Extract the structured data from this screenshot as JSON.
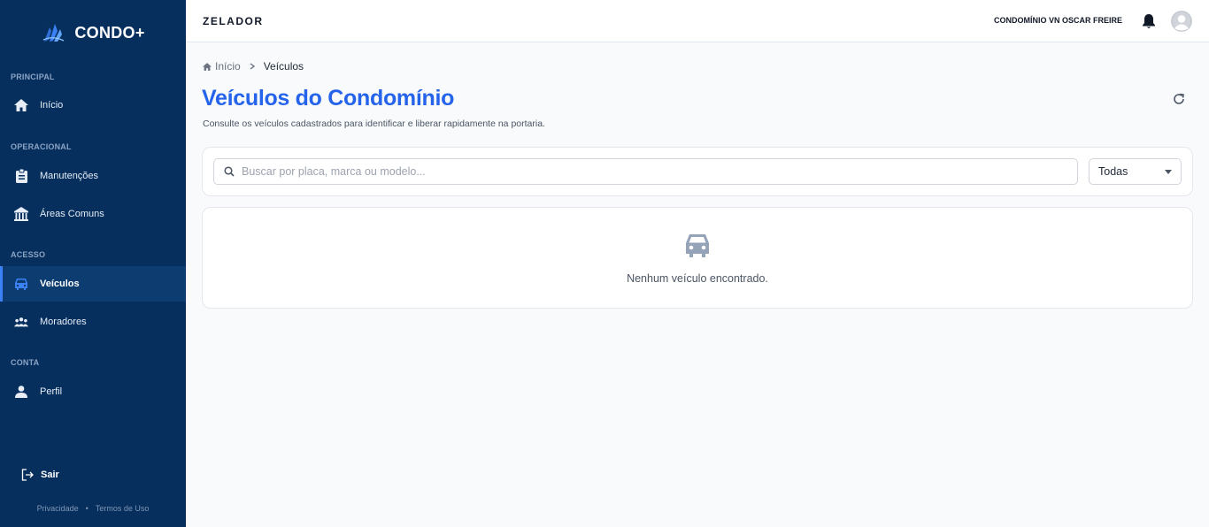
{
  "brand": {
    "name": "CONDO+"
  },
  "sidebar": {
    "sections": [
      {
        "label": "PRINCIPAL"
      },
      {
        "label": "OPERACIONAL"
      },
      {
        "label": "ACESSO"
      },
      {
        "label": "CONTA"
      }
    ],
    "items": [
      {
        "label": "Início",
        "icon": "home-icon",
        "active": false
      },
      {
        "label": "Manutenções",
        "icon": "clipboard-icon",
        "active": false
      },
      {
        "label": "Áreas Comuns",
        "icon": "building-icon",
        "active": false
      },
      {
        "label": "Veículos",
        "icon": "car-icon",
        "active": true
      },
      {
        "label": "Moradores",
        "icon": "users-icon",
        "active": false
      },
      {
        "label": "Perfil",
        "icon": "user-icon",
        "active": false
      }
    ],
    "logout_label": "Sair",
    "footer": {
      "privacy": "Privacidade",
      "separator": "•",
      "terms": "Termos de Uso"
    }
  },
  "header": {
    "role": "ZELADOR",
    "condo_name": "CONDOMÍNIO VN OSCAR FREIRE"
  },
  "breadcrumb": {
    "home": "Início",
    "current": "Veículos"
  },
  "page": {
    "title": "Veículos do Condomínio",
    "subtitle": "Consulte os veículos cadastrados para identificar e liberar rapidamente na portaria."
  },
  "filters": {
    "search_placeholder": "Buscar por placa, marca ou modelo...",
    "search_value": "",
    "select_value": "Todas"
  },
  "empty_state": {
    "message": "Nenhum veículo encontrado."
  },
  "colors": {
    "sidebar_bg": "#062f5e",
    "accent": "#2563eb",
    "active_border": "#3b82f6"
  }
}
